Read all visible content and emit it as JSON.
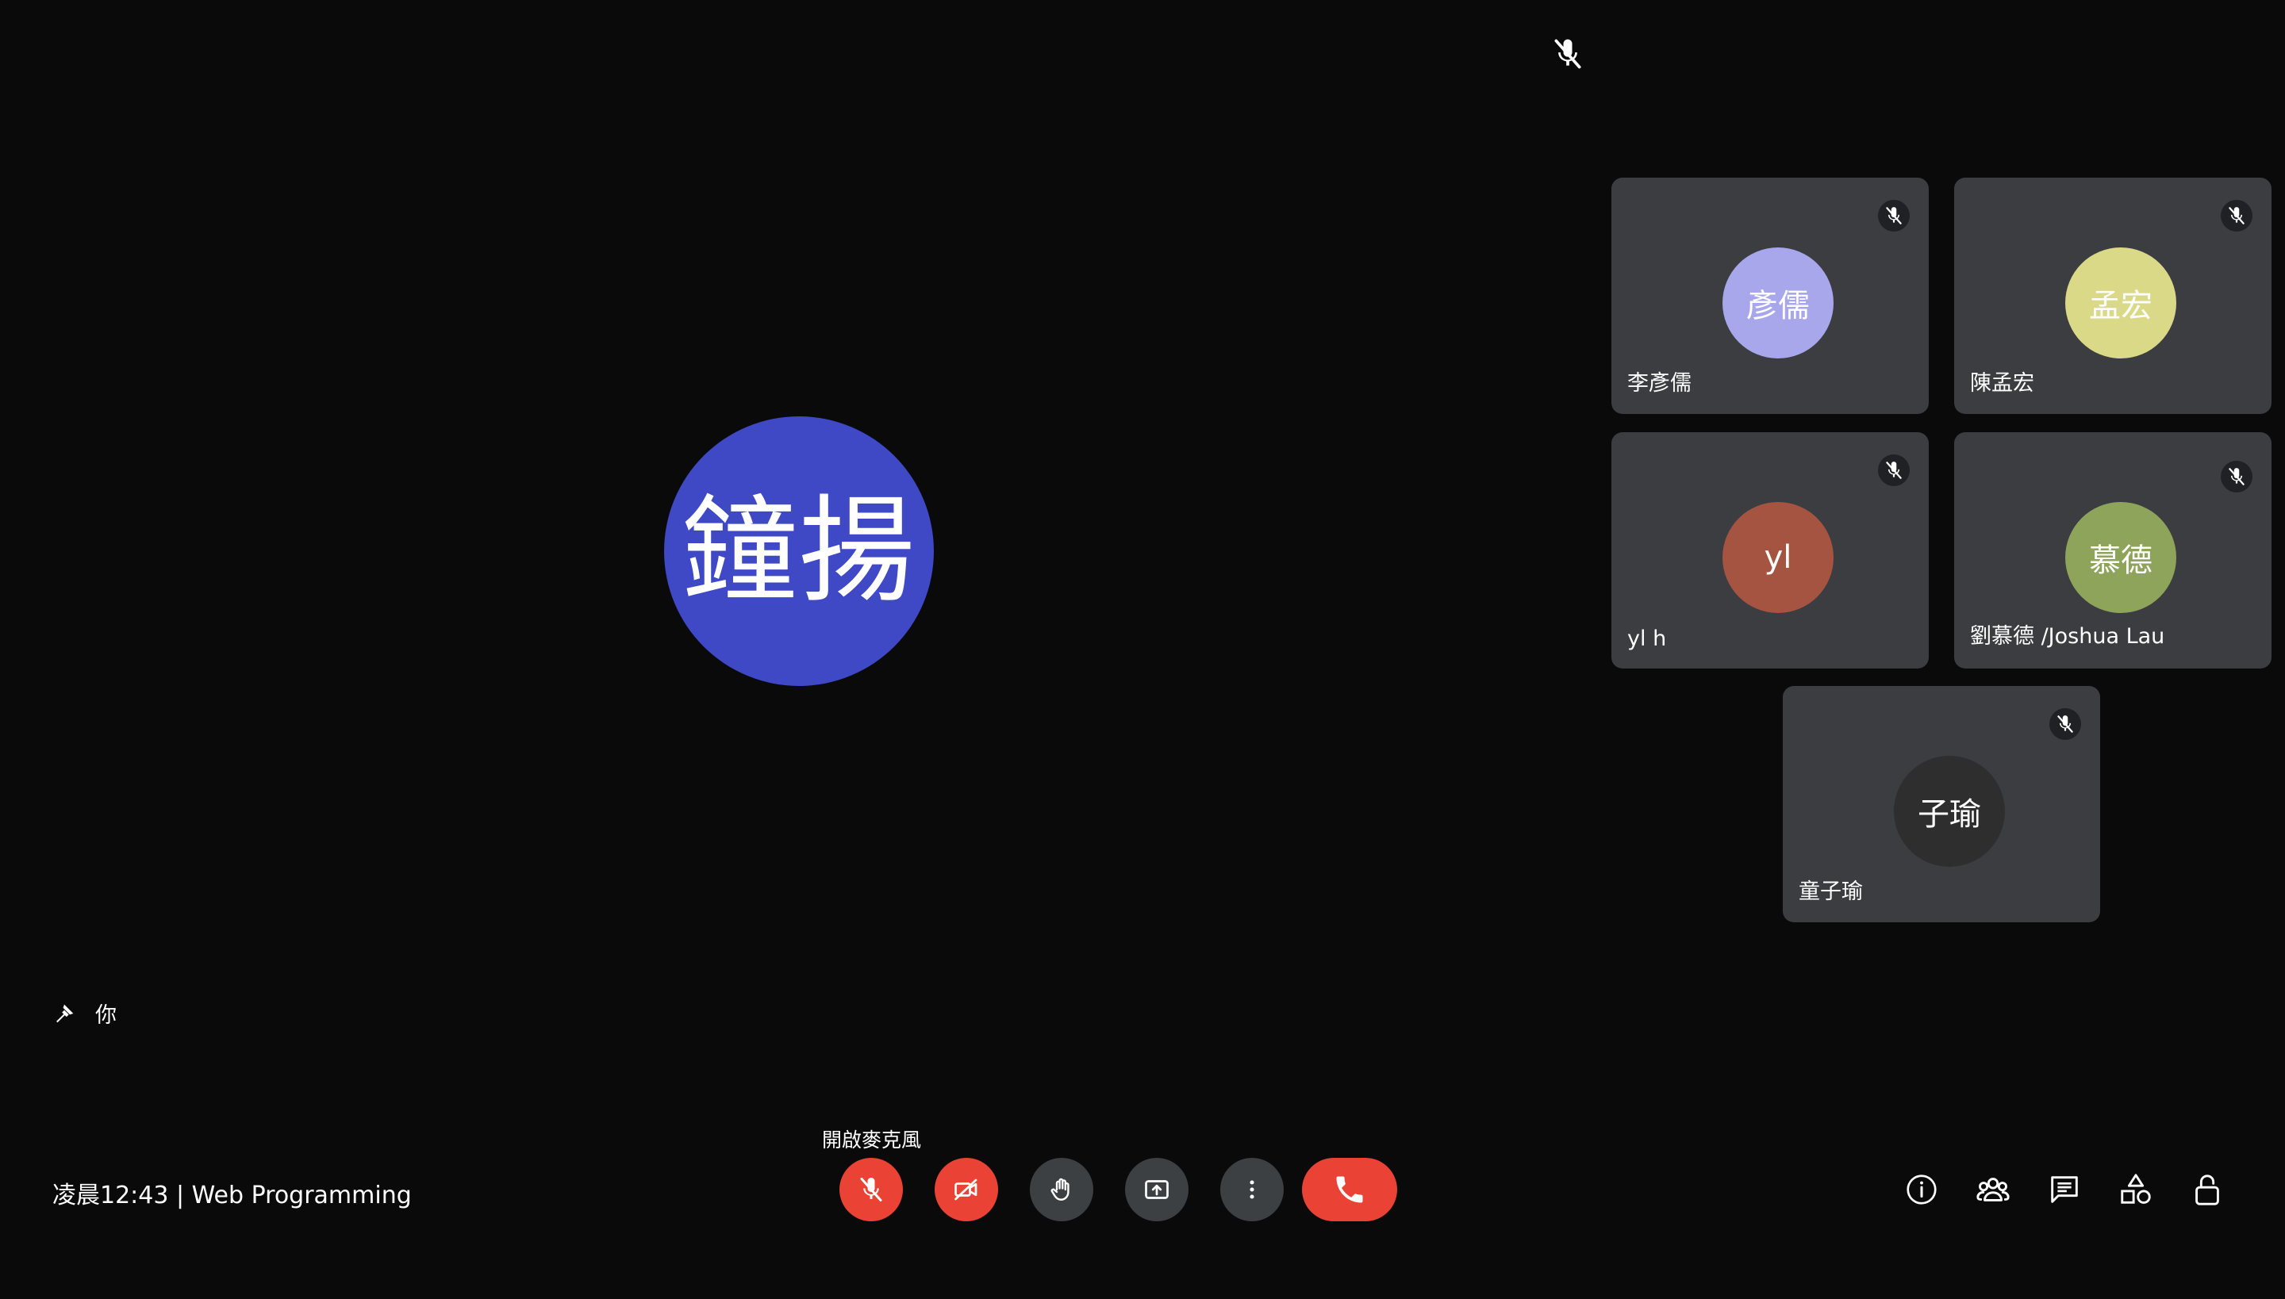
{
  "self": {
    "avatar_text": "鐘揚",
    "avatar_color": "#3f48c5",
    "pin_label": "你",
    "mic_state": "muted"
  },
  "participants": [
    {
      "initials": "彥儒",
      "name": "李彥儒",
      "color": "#a8a7ec",
      "mic_state": "muted"
    },
    {
      "initials": "孟宏",
      "name": "陳孟宏",
      "color": "#d9d987",
      "mic_state": "muted"
    },
    {
      "initials": "yl",
      "name": "yl h",
      "color": "#a55441",
      "mic_state": "muted"
    },
    {
      "initials": "慕德",
      "name": "劉慕德 /Joshua Lau",
      "color": "#8ea45a",
      "mic_state": "muted"
    },
    {
      "initials": "子瑜",
      "name": "童子瑜",
      "color": "#2e2e2e",
      "mic_state": "muted"
    }
  ],
  "bottom_bar": {
    "meeting_info": "凌晨12:43 | Web Programming",
    "mic_tooltip": "開啟麥克風",
    "controls": [
      {
        "name": "microphone",
        "icon": "mic-off-icon",
        "state": "off"
      },
      {
        "name": "camera",
        "icon": "camera-off-icon",
        "state": "off"
      },
      {
        "name": "raise-hand",
        "icon": "hand-icon"
      },
      {
        "name": "present",
        "icon": "present-screen-icon"
      },
      {
        "name": "more-options",
        "icon": "more-vert-icon"
      },
      {
        "name": "end-call",
        "icon": "phone-hangup-icon"
      }
    ],
    "side_controls": [
      {
        "name": "meeting-details",
        "icon": "info-icon"
      },
      {
        "name": "people",
        "icon": "people-icon"
      },
      {
        "name": "chat",
        "icon": "chat-icon"
      },
      {
        "name": "activities",
        "icon": "activities-icon"
      },
      {
        "name": "host-controls",
        "icon": "lock-icon"
      }
    ]
  },
  "colors": {
    "background": "#0a0a0b",
    "tile": "#3c3d41",
    "danger": "#ea4335",
    "control": "#3c4043"
  }
}
